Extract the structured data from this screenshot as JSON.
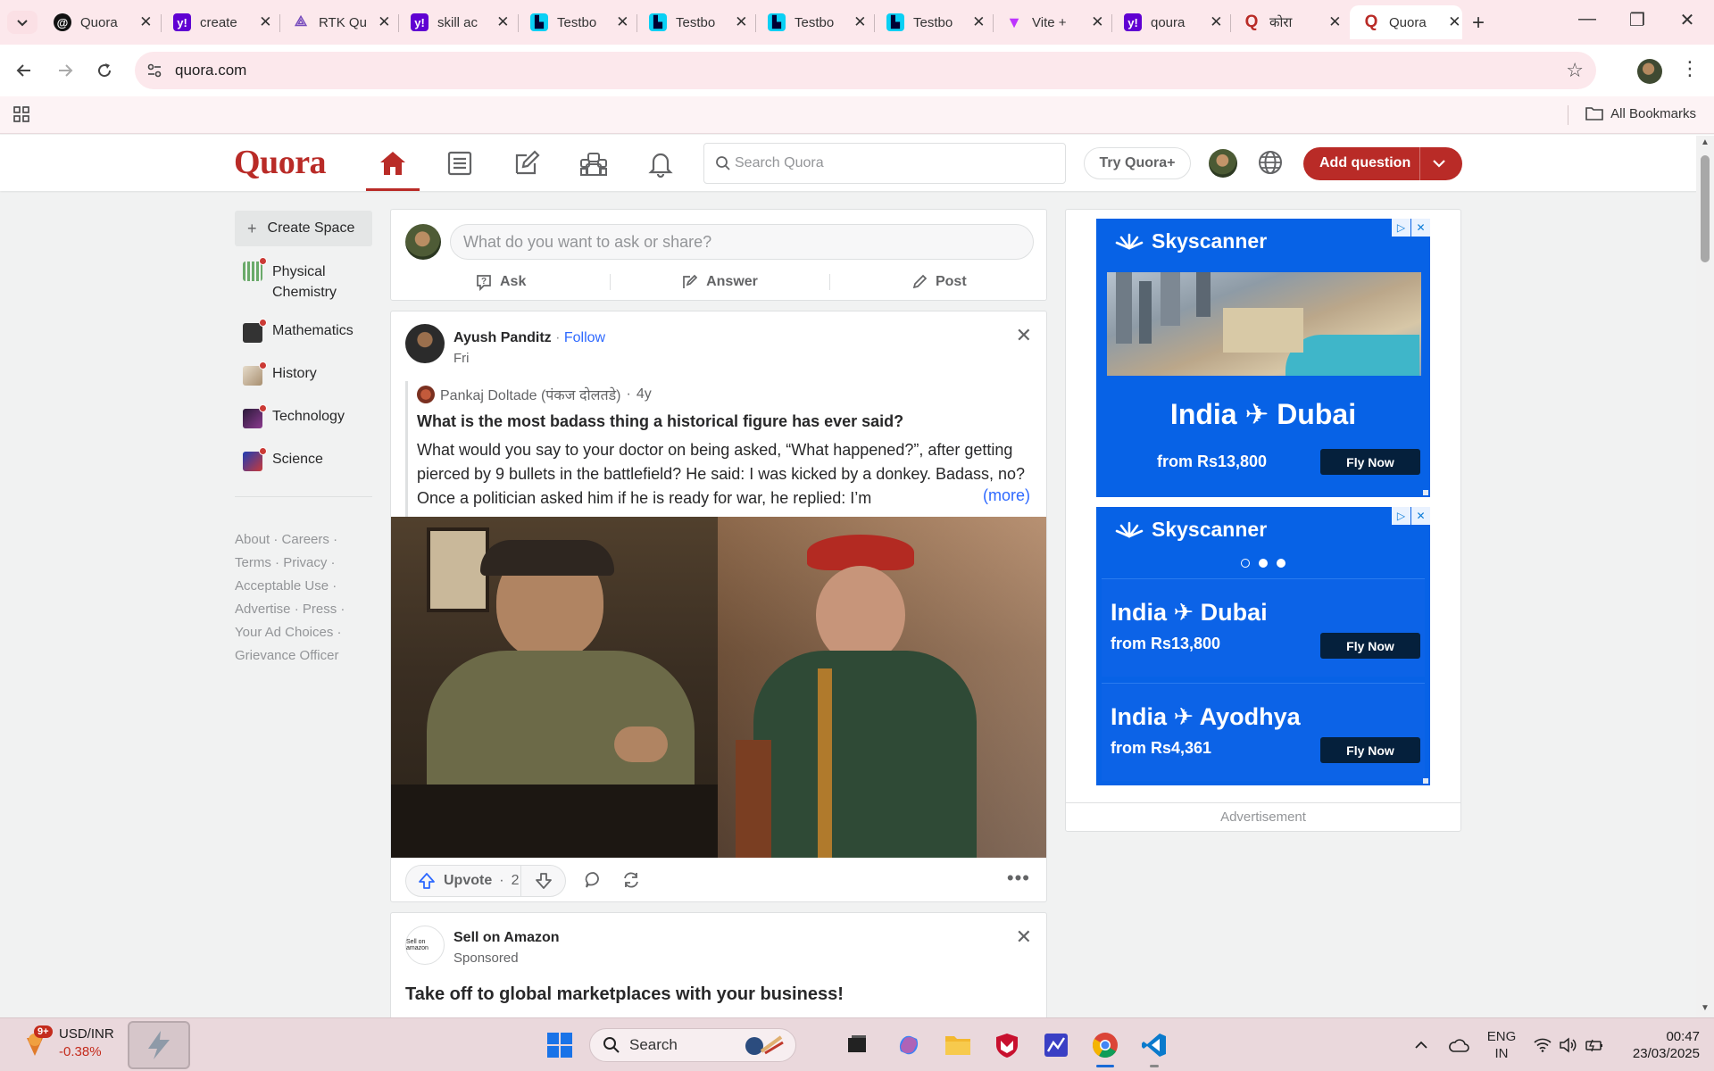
{
  "browser": {
    "tabs": [
      {
        "title": "Quora",
        "icon": "quora-threads-icon"
      },
      {
        "title": "create",
        "icon": "yahoo-icon"
      },
      {
        "title": "RTK Qu",
        "icon": "redux-icon"
      },
      {
        "title": "skill ac",
        "icon": "yahoo-icon"
      },
      {
        "title": "Testbo",
        "icon": "testbook-icon"
      },
      {
        "title": "Testbo",
        "icon": "testbook-icon"
      },
      {
        "title": "Testbo",
        "icon": "testbook-icon"
      },
      {
        "title": "Testbo",
        "icon": "testbook-icon"
      },
      {
        "title": "Vite +",
        "icon": "vite-icon"
      },
      {
        "title": "qoura",
        "icon": "yahoo-icon"
      },
      {
        "title": "कोरा",
        "icon": "quora-q-icon"
      },
      {
        "title": "Quora",
        "icon": "quora-q-icon",
        "active": true
      }
    ],
    "url": "quora.com",
    "bookmarks_label": "All Bookmarks"
  },
  "quora": {
    "logo": "Quora",
    "search_placeholder": "Search Quora",
    "try_plus": "Try Quora+",
    "add_question": "Add question",
    "brand_color": "#b92b27"
  },
  "sidebar": {
    "create_space": "Create Space",
    "spaces": [
      {
        "label": "Physical Chemistry",
        "color": "#2e8b57"
      },
      {
        "label": "Mathematics",
        "color": "#333333"
      },
      {
        "label": "History",
        "color": "#c8b59a"
      },
      {
        "label": "Technology",
        "color": "#5a2a6e"
      },
      {
        "label": "Science",
        "color": "#2b3fa8"
      }
    ],
    "footer_links": [
      "About",
      "Careers",
      "Terms",
      "Privacy",
      "Acceptable Use",
      "Advertise",
      "Press",
      "Your Ad Choices",
      "Grievance Officer"
    ]
  },
  "askbox": {
    "placeholder": "What do you want to ask or share?",
    "ask": "Ask",
    "answer": "Answer",
    "post": "Post"
  },
  "post": {
    "author": "Ayush Panditz",
    "follow": "Follow",
    "date": "Fri",
    "source_author": "Pankaj Doltade (पंकज दोलतडे)",
    "source_age": "4y",
    "question": "What is the most badass thing a historical figure has ever said?",
    "excerpt": "What would you say to your doctor on being asked, “What happened?”, after getting pierced by 9 bullets in the battlefield? He said: I was kicked by a donkey. Badass, no? Once a politician asked him if he is ready for war, he replied: I’m",
    "more": "(more)",
    "upvote": "Upvote",
    "upvote_count": "2"
  },
  "sponsored": {
    "name": "Sell on Amazon",
    "logo_text": "Sell on amazon",
    "tag": "Sponsored",
    "headline": "Take off to global marketplaces with your business!"
  },
  "ads": {
    "brand": "Skyscanner",
    "ad1": {
      "route": "India ✈ Dubai",
      "from": "from Rs13,800",
      "cta": "Fly Now"
    },
    "ad2": {
      "offers": [
        {
          "route": "India ✈ Dubai",
          "from": "from Rs13,800",
          "cta": "Fly Now"
        },
        {
          "route": "India ✈ Ayodhya",
          "from": "from Rs4,361",
          "cta": "Fly Now"
        }
      ]
    },
    "label": "Advertisement"
  },
  "taskbar": {
    "ticker": "USD/INR",
    "change": "-0.38%",
    "notif_badge": "9+",
    "search": "Search",
    "lang_line1": "ENG",
    "lang_line2": "IN",
    "time": "00:47",
    "date": "23/03/2025"
  }
}
